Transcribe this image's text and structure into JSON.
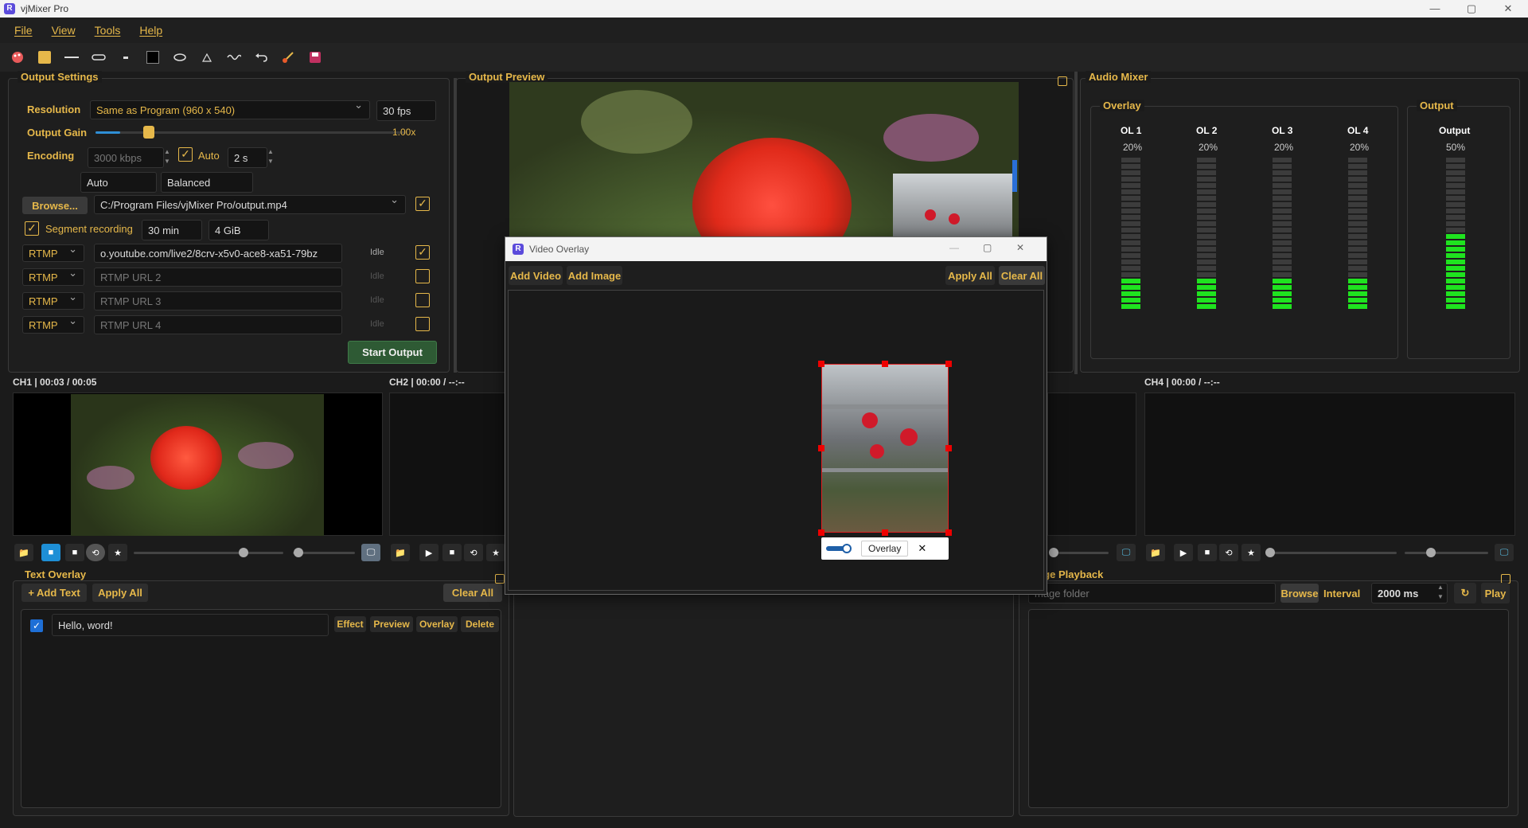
{
  "app": {
    "title": "vjMixer Pro",
    "logo": "R"
  },
  "window_controls": {
    "minimize": "—",
    "maximize": "▢",
    "close": "✕"
  },
  "menu": [
    "File",
    "View",
    "Tools",
    "Help"
  ],
  "toolbar_icons": [
    "palette-icon",
    "color-swatch-icon",
    "line-icon",
    "pen-icon",
    "dash-icon",
    "fill-square-icon",
    "ellipse-icon",
    "triangle-icon",
    "wave-icon",
    "undo-icon",
    "brush-icon",
    "save-icon"
  ],
  "output_settings": {
    "title": "Output Settings",
    "resolution_label": "Resolution",
    "resolution_value": "Same as Program (960 x 540)",
    "fps_value": "30 fps",
    "gain_label": "Output Gain",
    "gain_value": "1.00x",
    "gain_level": 0.5,
    "encoding_label": "Encoding",
    "bitrate_value": "3000 kbps",
    "auto_label": "Auto",
    "keyframe_value": "2 s",
    "preset_auto": "Auto",
    "preset_balanced": "Balanced",
    "browse_label": "Browse...",
    "path_value": "C:/Program Files/vjMixer Pro/output.mp4",
    "segment_label": "Segment recording",
    "segment_time": "30 min",
    "segment_size": "4 GiB",
    "rtmp_rows": [
      {
        "protocol": "RTMP",
        "url": "o.youtube.com/live2/8crv-x5v0-ace8-xa51-79bz",
        "placeholder": "",
        "status": "Idle",
        "checked": "✓"
      },
      {
        "protocol": "RTMP",
        "url": "",
        "placeholder": "RTMP URL 2",
        "status": "Idle",
        "checked": ""
      },
      {
        "protocol": "RTMP",
        "url": "",
        "placeholder": "RTMP URL 3",
        "status": "Idle",
        "checked": ""
      },
      {
        "protocol": "RTMP",
        "url": "",
        "placeholder": "RTMP URL 4",
        "status": "Idle",
        "checked": ""
      }
    ],
    "start_label": "Start Output"
  },
  "output_preview": {
    "title": "Output Preview"
  },
  "audio_mixer": {
    "title": "Audio Mixer",
    "overlay_group": "Overlay",
    "output_group": "Output",
    "channels": [
      {
        "name": "OL 1",
        "level": "20%"
      },
      {
        "name": "OL 2",
        "level": "20%"
      },
      {
        "name": "OL 3",
        "level": "20%"
      },
      {
        "name": "OL 4",
        "level": "20%"
      }
    ],
    "output": {
      "name": "Output",
      "level": "50%"
    }
  },
  "channels": [
    {
      "label": "CH1 | 00:03 / 00:05"
    },
    {
      "label": "CH2 | 00:00 / --:--"
    },
    {
      "label": "CH4 | 00:00 / --:--"
    }
  ],
  "text_overlay": {
    "title": "Text Overlay",
    "add_label": "+ Add Text",
    "apply_label": "Apply All",
    "clear_label": "Clear All",
    "items": [
      {
        "text": "Hello, word!",
        "actions": [
          "Effect",
          "Preview",
          "Overlay",
          "Delete"
        ]
      }
    ]
  },
  "image_playback": {
    "title": "Image Playback",
    "visible_title": "age Playback",
    "folder_placeholder": "mage folder",
    "browse_label": "Browse",
    "interval_label": "Interval",
    "interval_value": "2000 ms",
    "play_label": "Play"
  },
  "video_overlay_dialog": {
    "title": "Video Overlay",
    "add_video": "Add Video",
    "add_image": "Add Image",
    "apply_all": "Apply All",
    "clear_all": "Clear All",
    "overlay_item_label": "Overlay"
  },
  "colors": {
    "accent": "#e6b84a",
    "meter_on": "#1fe31f",
    "background": "#1b1b1b"
  }
}
